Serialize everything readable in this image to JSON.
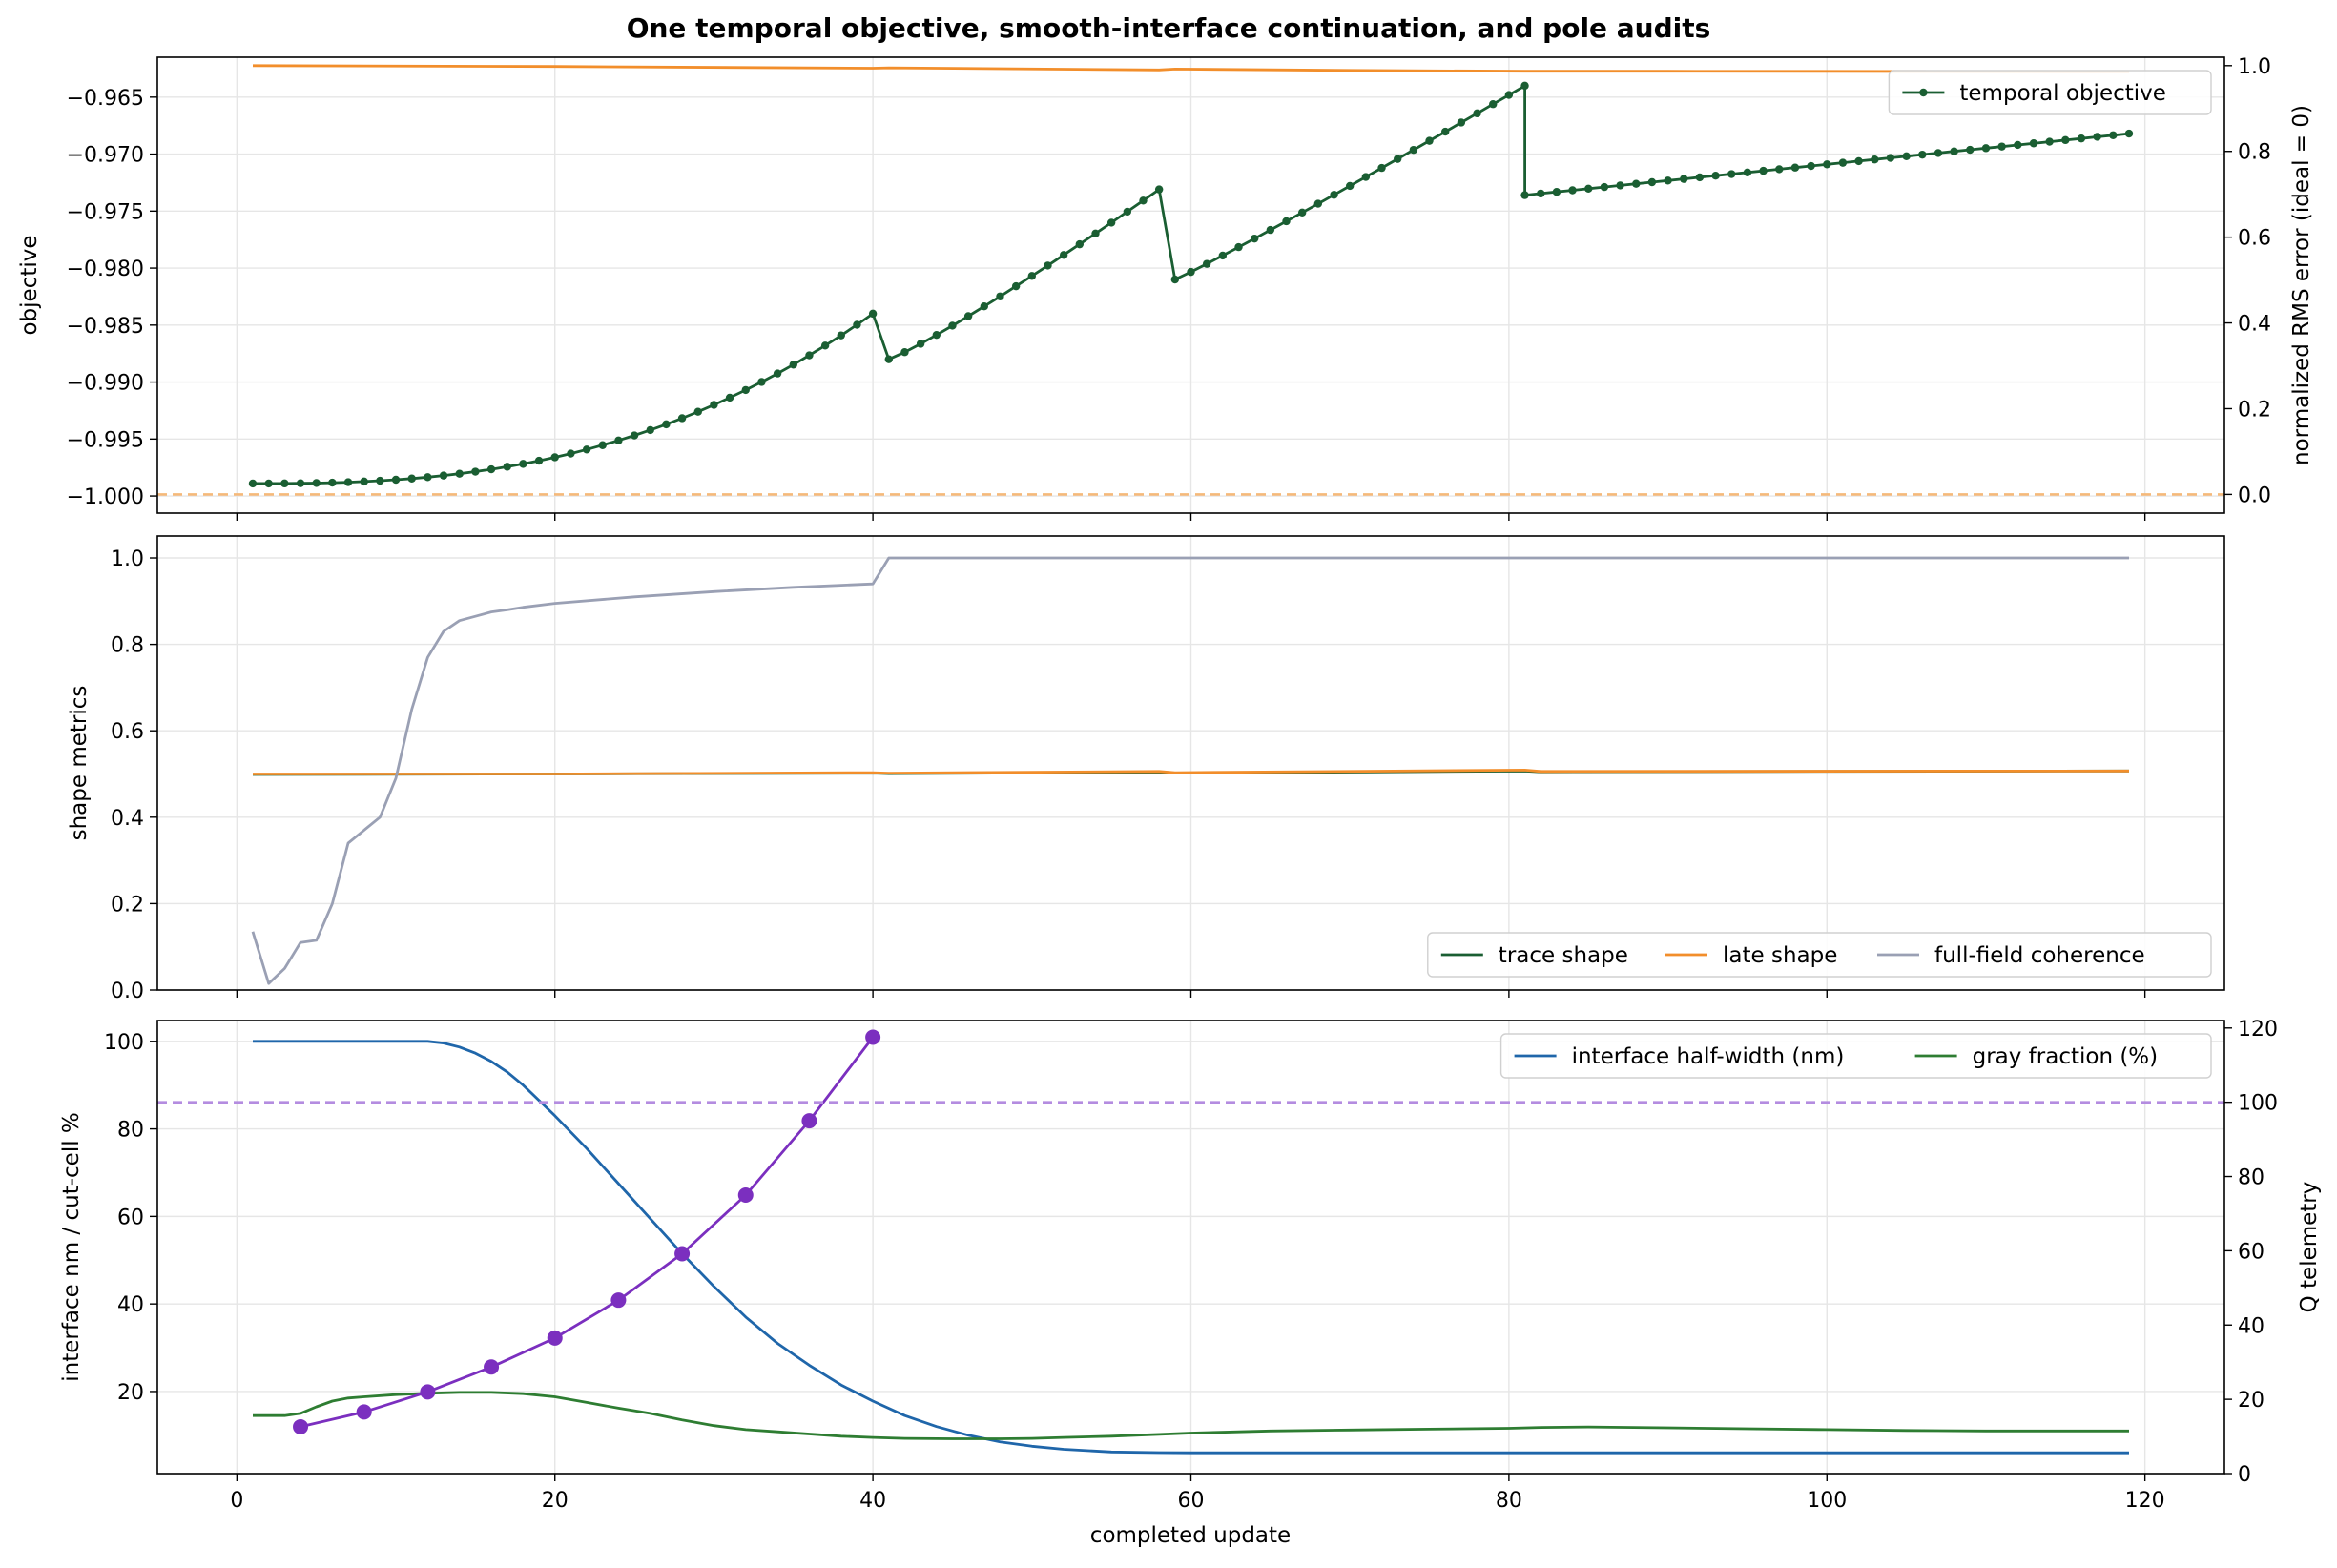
{
  "figure": {
    "title": "One temporal objective, smooth-interface continuation, and pole audits",
    "xlabel": "completed update"
  },
  "colors": {
    "objective": "#1a5e32",
    "rms": "#f28e2b",
    "rms_ideal": "#f5b97a",
    "trace": "#1a5e32",
    "late": "#f28e2b",
    "coherence": "#9aa0b4",
    "interface": "#1f66aa",
    "gray": "#2e7d32",
    "q": "#7b2fbf",
    "q_ref": "#b48ce0"
  },
  "chart_data": [
    {
      "type": "line",
      "panel": "top",
      "ylabel": "objective",
      "y2label": "normalized RMS error (ideal = 0)",
      "xlim": [
        -5,
        125
      ],
      "ylim": [
        -1.0015,
        -0.9615
      ],
      "y2lim": [
        -0.0436,
        1.0196
      ],
      "xticks": [
        0,
        20,
        40,
        60,
        80,
        100,
        120
      ],
      "yticks": [
        -1.0,
        -0.995,
        -0.99,
        -0.985,
        -0.98,
        -0.975,
        -0.97,
        -0.965
      ],
      "ytick_labels": [
        "−1.000",
        "−0.995",
        "−0.990",
        "−0.985",
        "−0.980",
        "−0.975",
        "−0.970",
        "−0.965"
      ],
      "y2ticks": [
        0.0,
        0.2,
        0.4,
        0.6,
        0.8,
        1.0
      ],
      "y2tick_labels": [
        "0.0",
        "0.2",
        "0.4",
        "0.6",
        "0.8",
        "1.0"
      ],
      "grid": true,
      "legend_position": "upper-right",
      "legend": [
        {
          "label": "temporal objective",
          "color_key": "objective",
          "marker": true
        }
      ],
      "series": [
        {
          "name": "temporal objective",
          "axis": "left",
          "color_key": "objective",
          "marker": "dot",
          "segments": [
            {
              "x_start": 1,
              "x_end": 40,
              "y_start": -0.9989,
              "y_end": -0.984,
              "exponent": 2.6
            },
            {
              "x_start": 41,
              "x_end": 58,
              "y_start": -0.988,
              "y_end": -0.9731,
              "exponent": 1.12
            },
            {
              "x_start": 59,
              "x_end": 81,
              "y_start": -0.981,
              "y_end": -0.964,
              "exponent": 1.05
            },
            {
              "x_start": 81,
              "x_end": 119,
              "y_start": -0.9736,
              "y_end": -0.9682,
              "exponent": 1.0
            }
          ]
        },
        {
          "axis": "right",
          "color_key": "rms",
          "marker": "none",
          "points": [
            [
              1,
              1.0
            ],
            [
              20,
              0.998
            ],
            [
              40,
              0.994
            ],
            [
              41,
              0.995
            ],
            [
              58,
              0.99
            ],
            [
              59,
              0.992
            ],
            [
              70,
              0.989
            ],
            [
              81,
              0.987
            ],
            [
              90,
              0.987
            ],
            [
              119,
              0.986
            ]
          ]
        },
        {
          "axis": "right",
          "color_key": "rms_ideal",
          "dashed": true,
          "hline": 0.0
        }
      ]
    },
    {
      "type": "line",
      "panel": "middle",
      "ylabel": "shape metrics",
      "xlim": [
        -5,
        125
      ],
      "ylim": [
        0.0,
        1.0508
      ],
      "xticks": [
        0,
        20,
        40,
        60,
        80,
        100,
        120
      ],
      "yticks": [
        0.0,
        0.2,
        0.4,
        0.6,
        0.8,
        1.0
      ],
      "ytick_labels": [
        "0.0",
        "0.2",
        "0.4",
        "0.6",
        "0.8",
        "1.0"
      ],
      "grid": true,
      "legend_position": "lower-right",
      "legend": [
        {
          "label": "trace shape",
          "color_key": "trace"
        },
        {
          "label": "late shape",
          "color_key": "late"
        },
        {
          "label": "full-field coherence",
          "color_key": "coherence"
        }
      ],
      "series": [
        {
          "name": "trace shape",
          "color_key": "trace",
          "points": [
            [
              1,
              0.499
            ],
            [
              20,
              0.5
            ],
            [
              40,
              0.502
            ],
            [
              41,
              0.501
            ],
            [
              58,
              0.504
            ],
            [
              59,
              0.502
            ],
            [
              81,
              0.507
            ],
            [
              82,
              0.505
            ],
            [
              119,
              0.507
            ]
          ]
        },
        {
          "name": "late shape",
          "color_key": "late",
          "points": [
            [
              1,
              0.5
            ],
            [
              20,
              0.5
            ],
            [
              40,
              0.503
            ],
            [
              41,
              0.502
            ],
            [
              58,
              0.506
            ],
            [
              59,
              0.503
            ],
            [
              81,
              0.509
            ],
            [
              82,
              0.506
            ],
            [
              119,
              0.507
            ]
          ]
        },
        {
          "name": "full-field coherence",
          "color_key": "coherence",
          "points": [
            [
              1,
              0.135
            ],
            [
              2,
              0.015
            ],
            [
              3,
              0.05
            ],
            [
              4,
              0.11
            ],
            [
              5,
              0.115
            ],
            [
              6,
              0.2
            ],
            [
              7,
              0.34
            ],
            [
              8,
              0.37
            ],
            [
              9,
              0.4
            ],
            [
              10,
              0.49
            ],
            [
              11,
              0.65
            ],
            [
              12,
              0.77
            ],
            [
              13,
              0.83
            ],
            [
              14,
              0.855
            ],
            [
              15,
              0.865
            ],
            [
              16,
              0.875
            ],
            [
              17,
              0.88
            ],
            [
              18,
              0.886
            ],
            [
              20,
              0.895
            ],
            [
              25,
              0.91
            ],
            [
              30,
              0.922
            ],
            [
              35,
              0.932
            ],
            [
              38,
              0.937
            ],
            [
              40,
              0.94
            ],
            [
              41,
              1.0
            ],
            [
              119,
              1.0
            ]
          ]
        }
      ]
    },
    {
      "type": "line",
      "panel": "bottom",
      "ylabel": "interface nm / cut-cell %",
      "y2label": "Q telemetry",
      "xlim": [
        -5,
        125
      ],
      "ylim": [
        1.25,
        104.75
      ],
      "y2lim": [
        0,
        122
      ],
      "xticks": [
        0,
        20,
        40,
        60,
        80,
        100,
        120
      ],
      "xtick_labels": [
        "0",
        "20",
        "40",
        "60",
        "80",
        "100",
        "120"
      ],
      "yticks": [
        20,
        40,
        60,
        80,
        100
      ],
      "ytick_labels": [
        "20",
        "40",
        "60",
        "80",
        "100"
      ],
      "y2ticks": [
        0,
        20,
        40,
        60,
        80,
        100,
        120
      ],
      "y2tick_labels": [
        "0",
        "20",
        "40",
        "60",
        "80",
        "100",
        "120"
      ],
      "grid": true,
      "legend_position": "upper-right",
      "legend": [
        {
          "label": "interface half-width (nm)",
          "color_key": "interface"
        },
        {
          "label": "gray fraction (%)",
          "color_key": "gray"
        }
      ],
      "series": [
        {
          "name": "interface half-width (nm)",
          "axis": "left",
          "color_key": "interface",
          "points": [
            [
              1,
              100
            ],
            [
              5,
              100
            ],
            [
              10,
              100
            ],
            [
              12,
              100
            ],
            [
              13,
              99.6
            ],
            [
              14,
              98.7
            ],
            [
              15,
              97.3
            ],
            [
              16,
              95.4
            ],
            [
              17,
              93
            ],
            [
              18,
              90
            ],
            [
              20,
              83
            ],
            [
              22,
              75.5
            ],
            [
              24,
              67.5
            ],
            [
              26,
              59.5
            ],
            [
              28,
              51.5
            ],
            [
              30,
              44
            ],
            [
              32,
              37
            ],
            [
              34,
              31
            ],
            [
              36,
              26
            ],
            [
              38,
              21.5
            ],
            [
              40,
              17.8
            ],
            [
              42,
              14.5
            ],
            [
              44,
              12
            ],
            [
              46,
              10
            ],
            [
              48,
              8.5
            ],
            [
              50,
              7.5
            ],
            [
              52,
              6.8
            ],
            [
              55,
              6.2
            ],
            [
              58,
              6.05
            ],
            [
              60,
              6
            ],
            [
              119,
              6
            ]
          ]
        },
        {
          "name": "gray fraction (%)",
          "axis": "left",
          "color_key": "gray",
          "points": [
            [
              1,
              14.5
            ],
            [
              3,
              14.5
            ],
            [
              4,
              15
            ],
            [
              5,
              16.5
            ],
            [
              6,
              17.8
            ],
            [
              7,
              18.5
            ],
            [
              8,
              18.8
            ],
            [
              10,
              19.3
            ],
            [
              12,
              19.6
            ],
            [
              14,
              19.8
            ],
            [
              16,
              19.8
            ],
            [
              18,
              19.5
            ],
            [
              20,
              18.8
            ],
            [
              22,
              17.5
            ],
            [
              24,
              16.2
            ],
            [
              26,
              15
            ],
            [
              28,
              13.5
            ],
            [
              30,
              12.2
            ],
            [
              32,
              11.3
            ],
            [
              34,
              10.8
            ],
            [
              36,
              10.3
            ],
            [
              38,
              9.8
            ],
            [
              40,
              9.5
            ],
            [
              42,
              9.3
            ],
            [
              45,
              9.2
            ],
            [
              48,
              9.2
            ],
            [
              50,
              9.3
            ],
            [
              52,
              9.5
            ],
            [
              55,
              9.8
            ],
            [
              58,
              10.2
            ],
            [
              60,
              10.5
            ],
            [
              65,
              11
            ],
            [
              70,
              11.2
            ],
            [
              75,
              11.4
            ],
            [
              80,
              11.6
            ],
            [
              82,
              11.8
            ],
            [
              85,
              11.9
            ],
            [
              90,
              11.7
            ],
            [
              95,
              11.5
            ],
            [
              100,
              11.3
            ],
            [
              105,
              11.1
            ],
            [
              110,
              11
            ],
            [
              115,
              11
            ],
            [
              119,
              11
            ]
          ]
        },
        {
          "axis": "right",
          "color_key": "q",
          "marker": "dot",
          "points": [
            [
              4,
              12.6
            ],
            [
              8,
              16.6
            ],
            [
              12,
              22
            ],
            [
              16,
              28.7
            ],
            [
              20,
              36.5
            ],
            [
              24,
              46.7
            ],
            [
              28,
              59.2
            ],
            [
              32,
              75
            ],
            [
              36,
              95
            ],
            [
              40,
              117.5
            ]
          ]
        },
        {
          "axis": "right",
          "color_key": "q_ref",
          "dashed": true,
          "hline": 100
        }
      ]
    }
  ]
}
